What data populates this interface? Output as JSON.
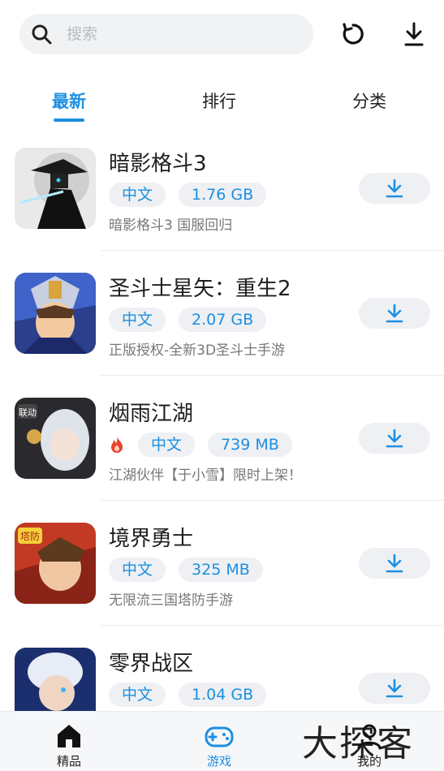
{
  "search": {
    "placeholder": "搜索",
    "icon": "search-icon"
  },
  "top_actions": {
    "refresh_icon": "refresh-icon",
    "download_icon": "download-icon"
  },
  "tabs": [
    {
      "label": "最新",
      "active": true
    },
    {
      "label": "排行",
      "active": false
    },
    {
      "label": "分类",
      "active": false
    }
  ],
  "games": [
    {
      "name": "暗影格斗3",
      "hot": false,
      "tags": [
        "中文",
        "1.76 GB"
      ],
      "desc": "暗影格斗3 国服回归"
    },
    {
      "name": "圣斗士星矢：重生2",
      "hot": false,
      "tags": [
        "中文",
        "2.07 GB"
      ],
      "desc": "正版授权-全新3D圣斗士手游"
    },
    {
      "name": "烟雨江湖",
      "hot": true,
      "tags": [
        "中文",
        "739 MB"
      ],
      "desc": "江湖伙伴【于小雪】限时上架！"
    },
    {
      "name": "境界勇士",
      "hot": false,
      "tags": [
        "中文",
        "325 MB"
      ],
      "desc": "无限流三国塔防手游"
    },
    {
      "name": "零界战区",
      "hot": false,
      "tags": [
        "中文",
        "1.04 GB"
      ],
      "desc": ""
    }
  ],
  "bottom_nav": [
    {
      "label": "精品",
      "icon": "home-icon",
      "active": false
    },
    {
      "label": "游戏",
      "icon": "gamepad-icon",
      "active": true
    },
    {
      "label": "我的",
      "icon": "user-icon",
      "active": false
    }
  ],
  "watermark": "大探客",
  "colors": {
    "accent": "#1d8fe1",
    "tag_bg": "#eef0f3",
    "hot": "#e8432b"
  }
}
